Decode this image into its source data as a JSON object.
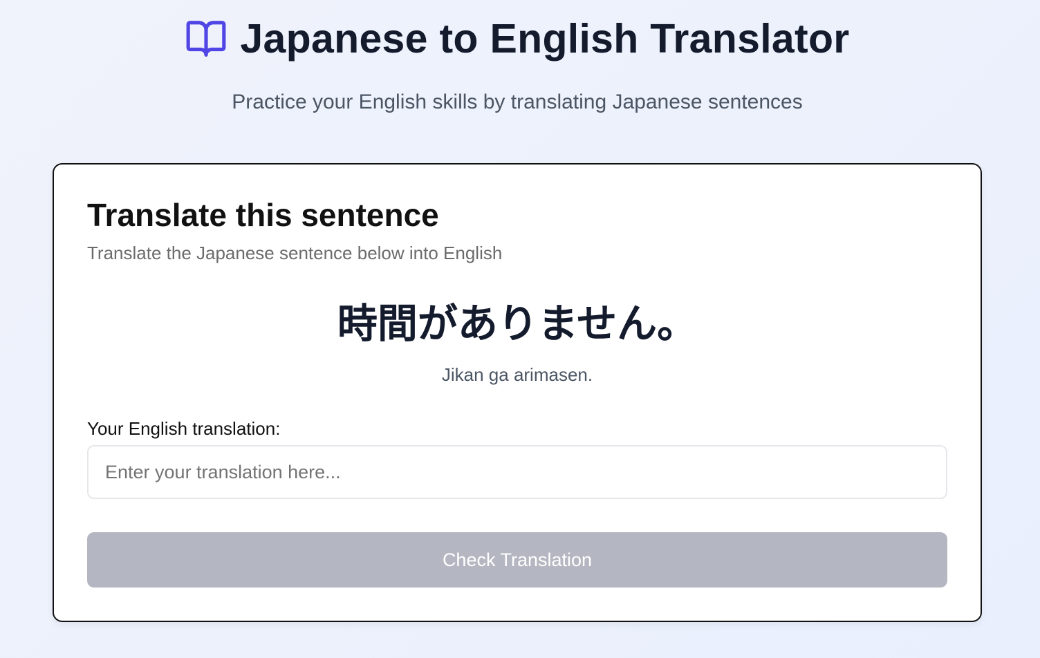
{
  "header": {
    "icon": "book-open-icon",
    "title": "Japanese to English Translator",
    "subtitle": "Practice your English skills by translating Japanese sentences"
  },
  "card": {
    "title": "Translate this sentence",
    "description": "Translate the Japanese sentence below into English",
    "japanese_sentence": "時間がありません。",
    "romaji": "Jikan ga arimasen.",
    "input_label": "Your English translation:",
    "input_value": "",
    "input_placeholder": "Enter your translation here...",
    "button_label": "Check Translation"
  },
  "colors": {
    "accent": "#4f46e5",
    "button_disabled": "#b4b7c1",
    "title_text": "#141b2d"
  }
}
